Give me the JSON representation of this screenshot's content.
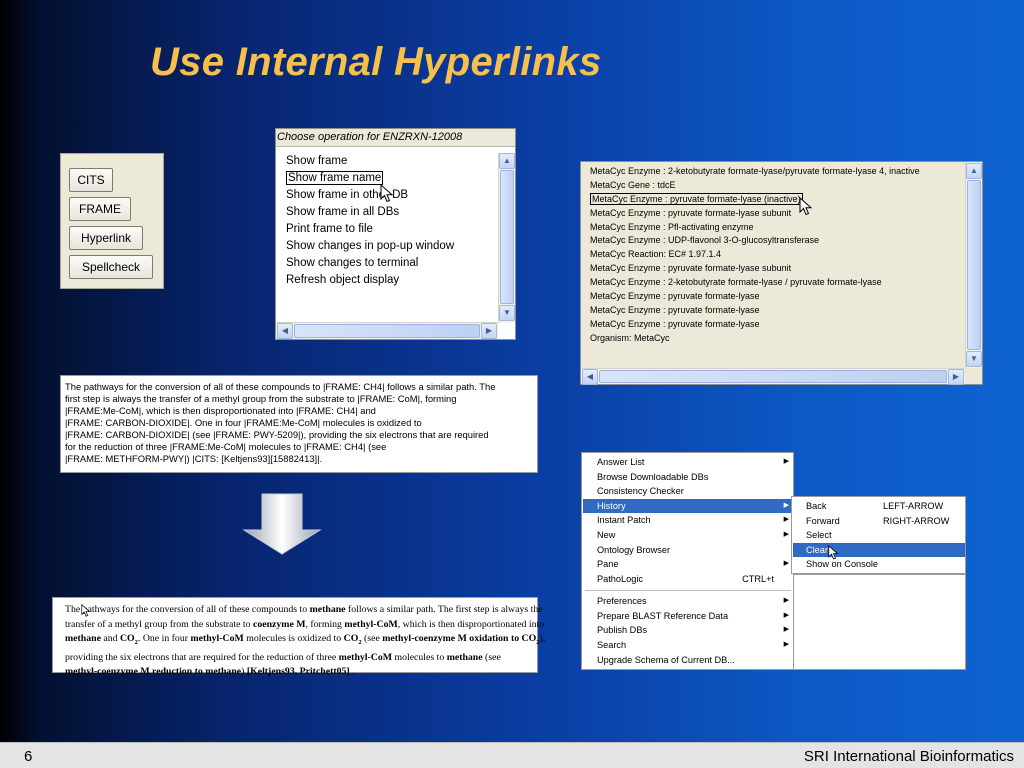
{
  "slide": {
    "title": "Use Internal Hyperlinks",
    "page_number": "6",
    "organization": "SRI International Bioinformatics"
  },
  "buttons": [
    "CITS",
    "FRAME",
    "Hyperlink",
    "Spellcheck"
  ],
  "operation_dialog": {
    "title": "Choose operation for ENZRXN-12008",
    "items": [
      "Show frame",
      "Show frame name",
      "Show frame in other DB",
      "Show frame in all DBs",
      "Print frame to file",
      "Show changes in pop-up window",
      "Show changes to terminal",
      "Refresh object display"
    ],
    "selected_index": 1
  },
  "results_list": {
    "lines": [
      "MetaCyc Enzyme  : 2-ketobutyrate formate-lyase/pyruvate formate-lyase 4, inactive",
      "MetaCyc Gene   : tdcE",
      "MetaCyc Enzyme  : pyruvate formate-lyase (inactive)",
      "MetaCyc Enzyme  : pyruvate formate-lyase subunit",
      "MetaCyc Enzyme  : Pfl-activating enzyme",
      "MetaCyc Enzyme  : UDP-flavonol 3-O-glucosyltransferase",
      "MetaCyc Reaction: EC# 1.97.1.4",
      "MetaCyc Enzyme  : pyruvate formate-lyase subunit",
      "MetaCyc Enzyme  : 2-ketobutyrate formate-lyase / pyruvate formate-lyase",
      "MetaCyc Enzyme  : pyruvate formate-lyase",
      "MetaCyc Enzyme  : pyruvate formate-lyase",
      "MetaCyc Enzyme  : pyruvate formate-lyase",
      "Organism: MetaCyc"
    ],
    "selected_index": 2
  },
  "raw_text": {
    "lines": [
      "The pathways for the conversion of all of these compounds to |FRAME: CH4| follows a similar path. The",
      "first step is always the transfer of a methyl group from the substrate to |FRAME: CoM|, forming",
      "|FRAME:Me-CoM|, which is then disproportionated into |FRAME: CH4| and",
      "|FRAME: CARBON-DIOXIDE|. One in four |FRAME:Me-CoM| molecules is oxidized to",
      "|FRAME: CARBON-DIOXIDE| (see |FRAME: PWY-5209|), providing the six electrons that are required",
      "for the reduction of three |FRAME:Me-CoM| molecules to |FRAME: CH4| (see",
      "|FRAME: METHFORM-PWY|) |CITS: [Keltjens93][15882413]|."
    ]
  },
  "rendered_text": {
    "l1a": "The pathways for the conversion of all of these compounds to ",
    "l1b": "methane",
    "l1c": " follows a similar path. The first step is always the",
    "l2a": "transfer of a methyl group from the substrate to ",
    "l2b": "coenzyme M",
    "l2c": ", forming ",
    "l2d": "methyl-CoM",
    "l2e": ", which is then disproportionated into",
    "l3a": "methane",
    "l3b": " and ",
    "l3c": "CO",
    "l3d": "2",
    "l3e": ". One in four ",
    "l3f": "methyl-CoM",
    "l3g": " molecules is oxidized to ",
    "l3h": "CO",
    "l3i": "2",
    "l3j": " (see ",
    "l3k": "methyl-coenzyme M oxidation to CO",
    "l3l": "2",
    "l3m": "),",
    "l4a": "providing the six electrons that are required for the reduction of three ",
    "l4b": "methyl-CoM",
    "l4c": " molecules to ",
    "l4d": "methane",
    "l4e": " (see",
    "l5a": "methyl-coenzyme M reduction to methane",
    "l5b": ")  ",
    "l5c": "[Keltjens93, Pritchett05]",
    "l5d": " ."
  },
  "menu": {
    "items": [
      {
        "label": "Answer List",
        "submenu": true
      },
      {
        "label": "Browse Downloadable DBs"
      },
      {
        "label": "Consistency Checker"
      },
      {
        "label": "History",
        "submenu": true,
        "highlighted": true
      },
      {
        "label": "Instant Patch",
        "submenu": true
      },
      {
        "label": "New",
        "submenu": true
      },
      {
        "label": "Ontology Browser"
      },
      {
        "label": "Pane",
        "submenu": true
      },
      {
        "label": "PathoLogic",
        "shortcut": "CTRL+t"
      },
      {
        "label": "Preferences",
        "submenu": true
      },
      {
        "label": "Prepare BLAST Reference Data",
        "submenu": true
      },
      {
        "label": "Publish DBs",
        "submenu": true
      },
      {
        "label": "Search",
        "submenu": true
      },
      {
        "label": "Upgrade Schema of Current DB..."
      }
    ],
    "submenu_history": [
      {
        "label": "Back",
        "shortcut": "LEFT-ARROW"
      },
      {
        "label": "Forward",
        "shortcut": "RIGHT-ARROW"
      },
      {
        "label": "Select"
      },
      {
        "label": "Clear",
        "highlighted": true
      },
      {
        "label": "Show on Console"
      }
    ]
  },
  "icons": {
    "arrow_right": "▶",
    "arrow_up": "▲",
    "arrow_down": "▼",
    "arrow_left": "◀"
  },
  "colors": {
    "title": "#f7c04a",
    "highlight": "#316ac5",
    "panel_bg": "#ece9d8"
  }
}
